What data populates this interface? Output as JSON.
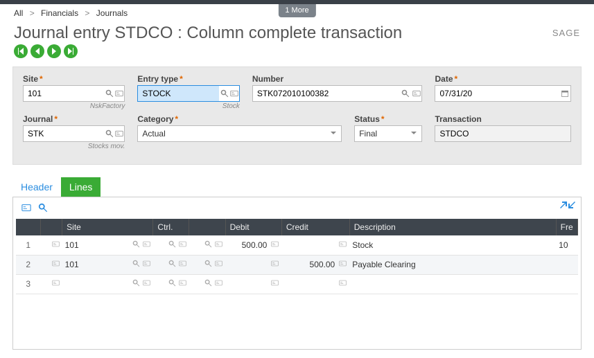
{
  "chrome": {
    "one_more": "1 More",
    "brand": "SAGE"
  },
  "breadcrumb": {
    "a": "All",
    "b": "Financials",
    "c": "Journals"
  },
  "page_title": "Journal entry STDCO : Column complete transaction",
  "form": {
    "site": {
      "label": "Site",
      "value": "101",
      "sub": "NskFactory"
    },
    "entry": {
      "label": "Entry type",
      "value": "STOCK",
      "sub": "Stock"
    },
    "number": {
      "label": "Number",
      "value": "STK072010100382"
    },
    "date": {
      "label": "Date",
      "value": "07/31/20"
    },
    "journal": {
      "label": "Journal",
      "value": "STK",
      "sub": "Stocks mov."
    },
    "category": {
      "label": "Category",
      "value": "Actual"
    },
    "status": {
      "label": "Status",
      "value": "Final"
    },
    "trans": {
      "label": "Transaction",
      "value": "STDCO"
    }
  },
  "tabs": {
    "header": "Header",
    "lines": "Lines"
  },
  "grid": {
    "columns": {
      "site": "Site",
      "ctrl": "Ctrl.",
      "debit": "Debit",
      "credit": "Credit",
      "desc": "Description",
      "fre": "Fre"
    },
    "rows": [
      {
        "n": "1",
        "site": "101",
        "debit": "500.00",
        "credit": "",
        "desc": "Stock",
        "fre": "10"
      },
      {
        "n": "2",
        "site": "101",
        "debit": "",
        "credit": "500.00",
        "desc": "Payable Clearing",
        "fre": ""
      },
      {
        "n": "3",
        "site": "",
        "debit": "",
        "credit": "",
        "desc": "",
        "fre": ""
      }
    ]
  }
}
